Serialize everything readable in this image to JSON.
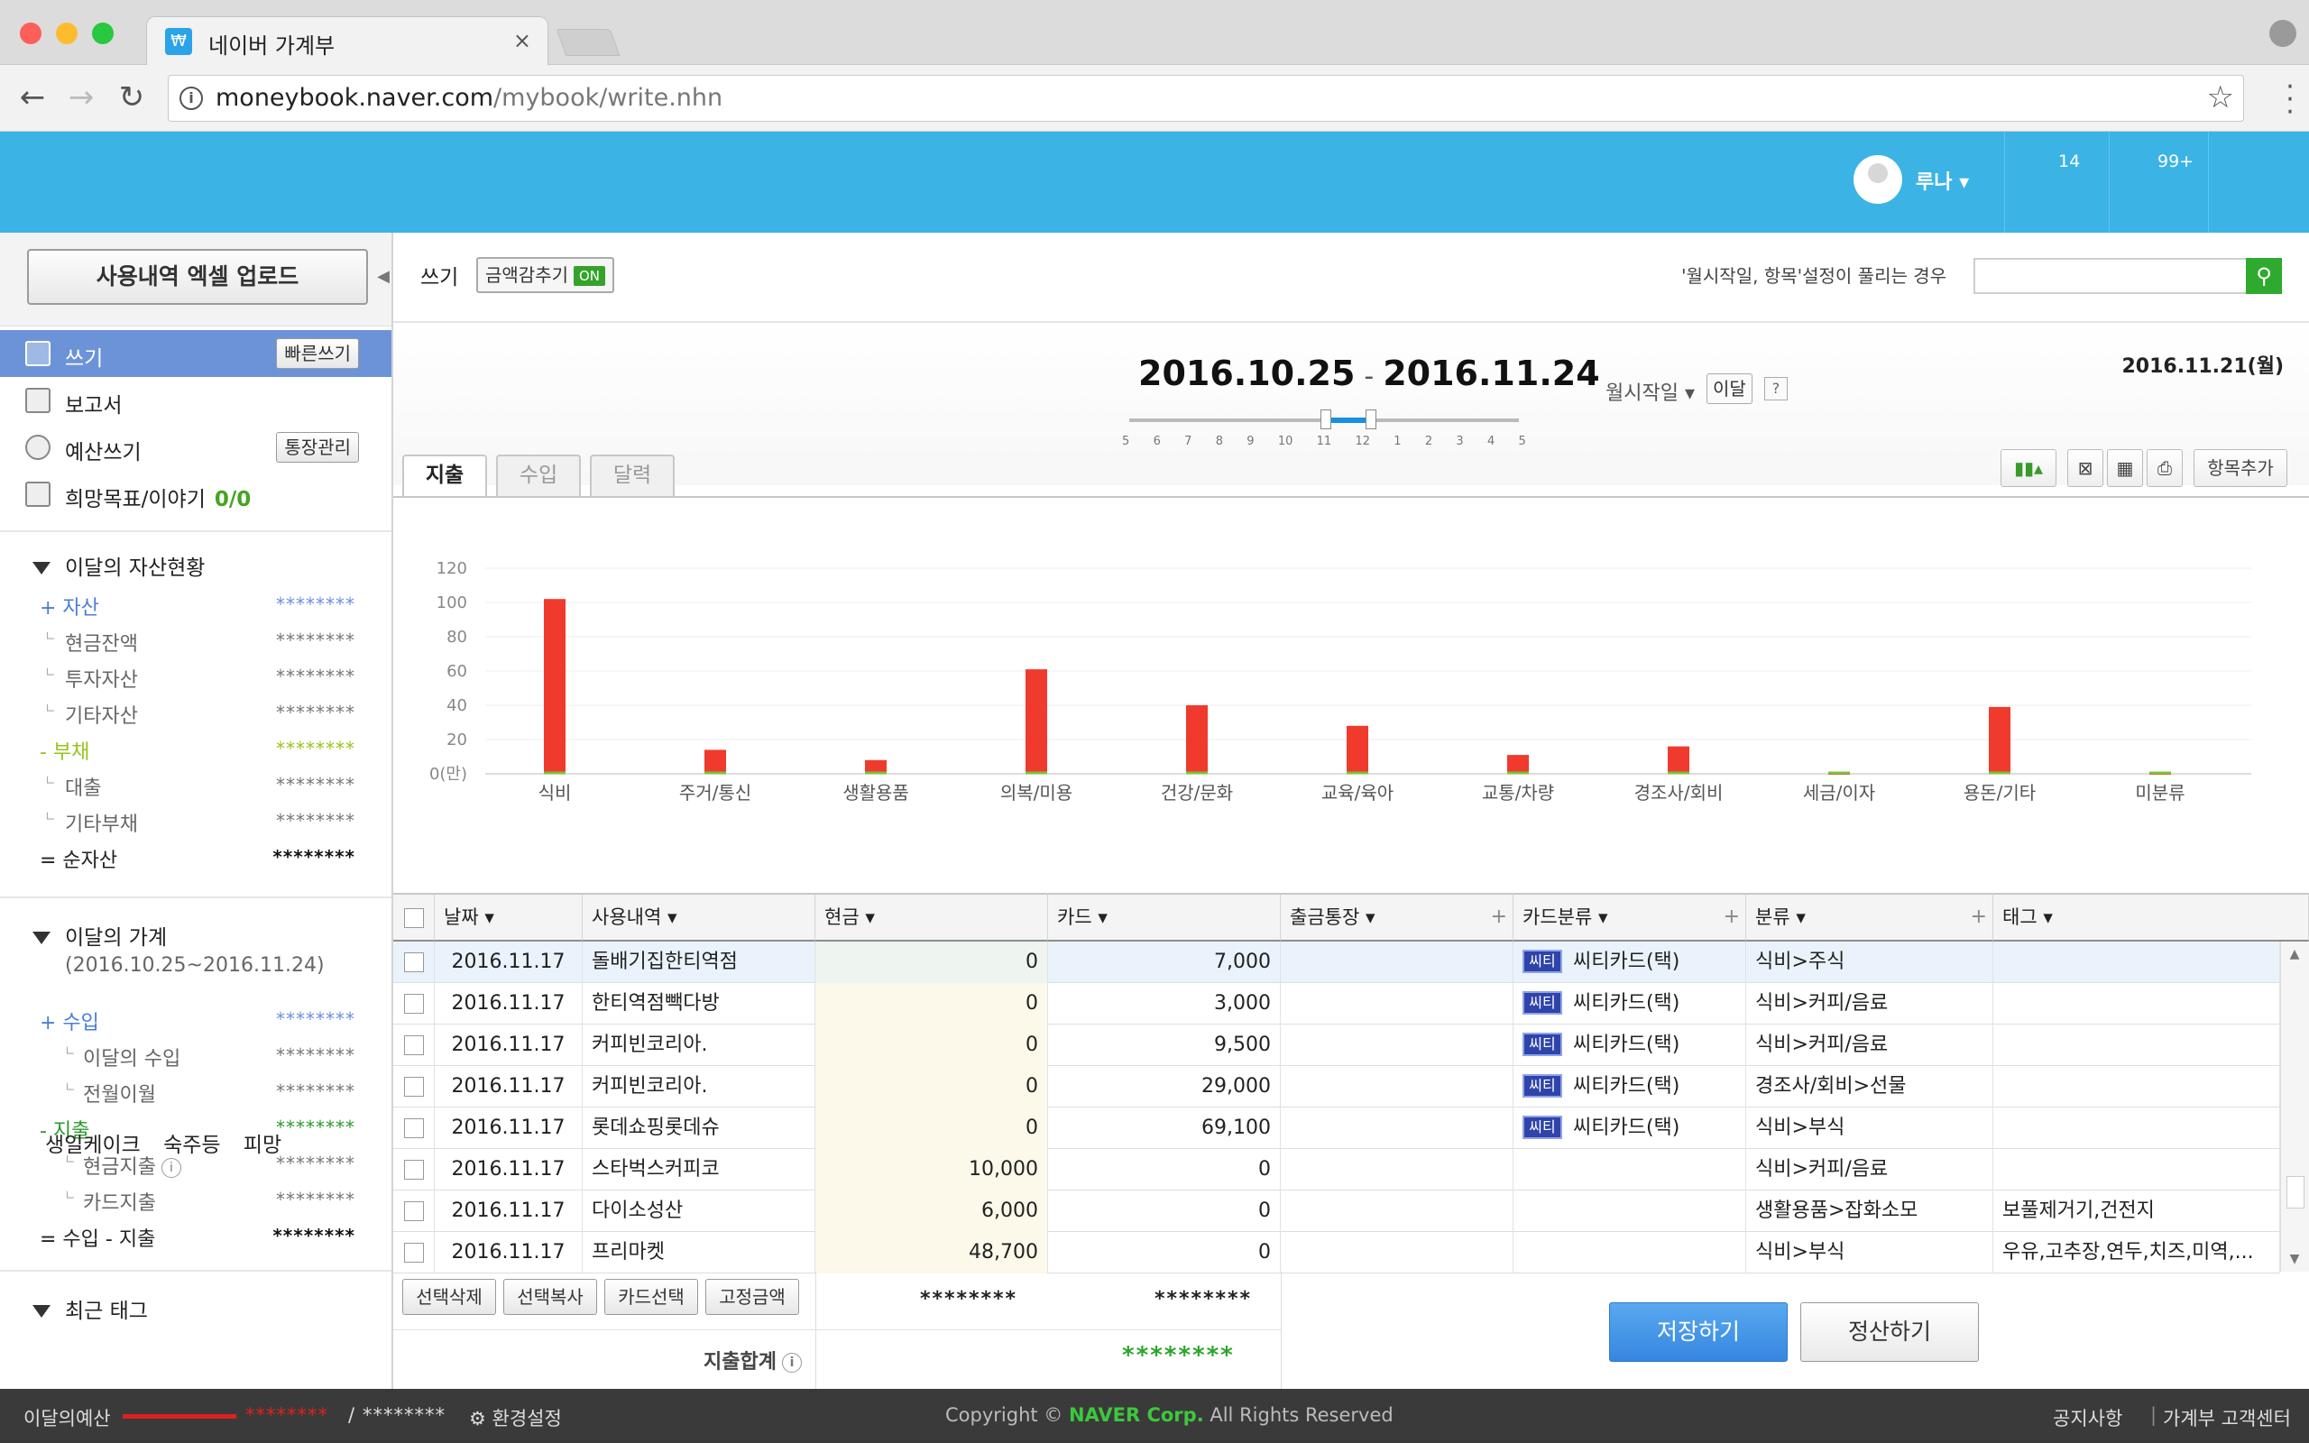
{
  "browser": {
    "tab_title": "네이버 가계부",
    "tab_close": "×",
    "url_host": "moneybook.naver.com",
    "url_path": "/mybook/write.nhn"
  },
  "header": {
    "username": "루나",
    "counts": [
      "14",
      "99+"
    ]
  },
  "sidebar": {
    "upload_button": "사용내역 엑셀 업로드",
    "menu": [
      {
        "label": "쓰기",
        "button": "빠른쓰기"
      },
      {
        "label": "보고서"
      },
      {
        "label": "예산쓰기",
        "button": "통장관리"
      },
      {
        "label": "희망목표/이야기",
        "count": "0/0"
      }
    ],
    "assets": {
      "title": "이달의 자산현황",
      "asset": {
        "label": "+ 자산",
        "value": "********"
      },
      "cash": {
        "label": "현금잔액",
        "value": "********"
      },
      "invest": {
        "label": "투자자산",
        "value": "********"
      },
      "other_asset": {
        "label": "기타자산",
        "value": "********"
      },
      "debt": {
        "label": "- 부채",
        "value": "********"
      },
      "loan": {
        "label": "대출",
        "value": "********"
      },
      "other_debt": {
        "label": "기타부채",
        "value": "********"
      },
      "net": {
        "label": "= 순자산",
        "value": "********"
      }
    },
    "ledger": {
      "title": "이달의 가계",
      "period": "(2016.10.25~2016.11.24)",
      "income": {
        "label": "+ 수입",
        "value": "********"
      },
      "month_income": {
        "label": "이달의 수입",
        "value": "********"
      },
      "carry": {
        "label": "전월이월",
        "value": "********"
      },
      "expense": {
        "label": "- 지출",
        "value": "********"
      },
      "cash_expense": {
        "label": "현금지출",
        "value": "********"
      },
      "card_expense": {
        "label": "카드지출",
        "value": "********"
      },
      "balance": {
        "label": "= 수입 - 지출",
        "value": "********"
      }
    },
    "recent_tags": {
      "title": "최근 태그",
      "tags": "생일케이크 숙주등 피망"
    }
  },
  "main": {
    "write_label": "쓰기",
    "hide_amount": "금액감추기",
    "hide_amount_state": "ON",
    "search_hint": "'월시작일, 항목'설정이 풀리는 경우",
    "search_placeholder": "",
    "period_start": "2016.10.25",
    "period_sep": "-",
    "period_end": "2016.11.24",
    "slider_ticks": [
      "5",
      "6",
      "7",
      "8",
      "9",
      "10",
      "11",
      "12",
      "1",
      "2",
      "3",
      "4",
      "5"
    ],
    "month_start": "월시작일 ▾",
    "this_month": "이달",
    "help": "?",
    "today": "2016.11.21(월)",
    "tabs": [
      "지출",
      "수입",
      "달력"
    ],
    "toolbar": {
      "add_item": "항목추가"
    }
  },
  "chart_data": {
    "type": "bar",
    "ylabel": "0(만)",
    "ylim": [
      0,
      120
    ],
    "yticks": [
      0,
      20,
      40,
      60,
      80,
      100,
      120
    ],
    "ytick_labels": [
      "0(만)",
      "20",
      "40",
      "60",
      "80",
      "100",
      "120"
    ],
    "categories": [
      "식비",
      "주거/통신",
      "생활용품",
      "의복/미용",
      "건강/문화",
      "교육/육아",
      "교통/차량",
      "경조사/회비",
      "세금/이자",
      "용돈/기타",
      "미분류"
    ],
    "values": [
      102,
      14,
      8,
      61,
      40,
      28,
      11,
      16,
      0.5,
      39,
      0.5
    ],
    "bar_color": "#f03a2e",
    "grid": true
  },
  "table": {
    "headers": [
      "날짜 ▾",
      "사용내역 ▾",
      "현금 ▾",
      "카드 ▾",
      "출금통장 ▾",
      "카드분류 ▾",
      "분류 ▾",
      "태그 ▾"
    ],
    "rows": [
      {
        "date": "2016.11.17",
        "desc": "돌배기집한티역점",
        "cash": "0",
        "card": "7,000",
        "card_tag": "씨티",
        "card_name": "씨티카드(택)",
        "category": "식비>주식",
        "tag": ""
      },
      {
        "date": "2016.11.17",
        "desc": "한티역점빽다방",
        "cash": "0",
        "card": "3,000",
        "card_tag": "씨티",
        "card_name": "씨티카드(택)",
        "category": "식비>커피/음료",
        "tag": ""
      },
      {
        "date": "2016.11.17",
        "desc": "커피빈코리아.",
        "cash": "0",
        "card": "9,500",
        "card_tag": "씨티",
        "card_name": "씨티카드(택)",
        "category": "식비>커피/음료",
        "tag": ""
      },
      {
        "date": "2016.11.17",
        "desc": "커피빈코리아.",
        "cash": "0",
        "card": "29,000",
        "card_tag": "씨티",
        "card_name": "씨티카드(택)",
        "category": "경조사/회비>선물",
        "tag": ""
      },
      {
        "date": "2016.11.17",
        "desc": "롯데쇼핑롯데슈",
        "cash": "0",
        "card": "69,100",
        "card_tag": "씨티",
        "card_name": "씨티카드(택)",
        "category": "식비>부식",
        "tag": ""
      },
      {
        "date": "2016.11.17",
        "desc": "스타벅스커피코",
        "cash": "10,000",
        "card": "0",
        "card_tag": "",
        "card_name": "",
        "category": "식비>커피/음료",
        "tag": ""
      },
      {
        "date": "2016.11.17",
        "desc": "다이소성산",
        "cash": "6,000",
        "card": "0",
        "card_tag": "",
        "card_name": "",
        "category": "생활용품>잡화소모",
        "tag": "보풀제거기,건전지"
      },
      {
        "date": "2016.11.17",
        "desc": "프리마켓",
        "cash": "48,700",
        "card": "0",
        "card_tag": "",
        "card_name": "",
        "category": "식비>부식",
        "tag": "우유,고추장,연두,치즈,미역,..."
      }
    ],
    "footer_buttons": [
      "선택삭제",
      "선택복사",
      "카드선택",
      "고정금액"
    ],
    "cash_sum": "********",
    "card_sum": "********",
    "total_label": "지출합계",
    "total_value": "********",
    "save": "저장하기",
    "settle": "정산하기"
  },
  "footer": {
    "budget_label": "이달의예산",
    "budget_used": "********",
    "budget_sep": "/",
    "budget_total": "********",
    "settings": "환경설정",
    "copyright_pre": "Copyright ©",
    "copyright_brand": "NAVER Corp.",
    "copyright_post": "All Rights Reserved",
    "notice": "공지사항",
    "support": "가계부 고객센터"
  }
}
